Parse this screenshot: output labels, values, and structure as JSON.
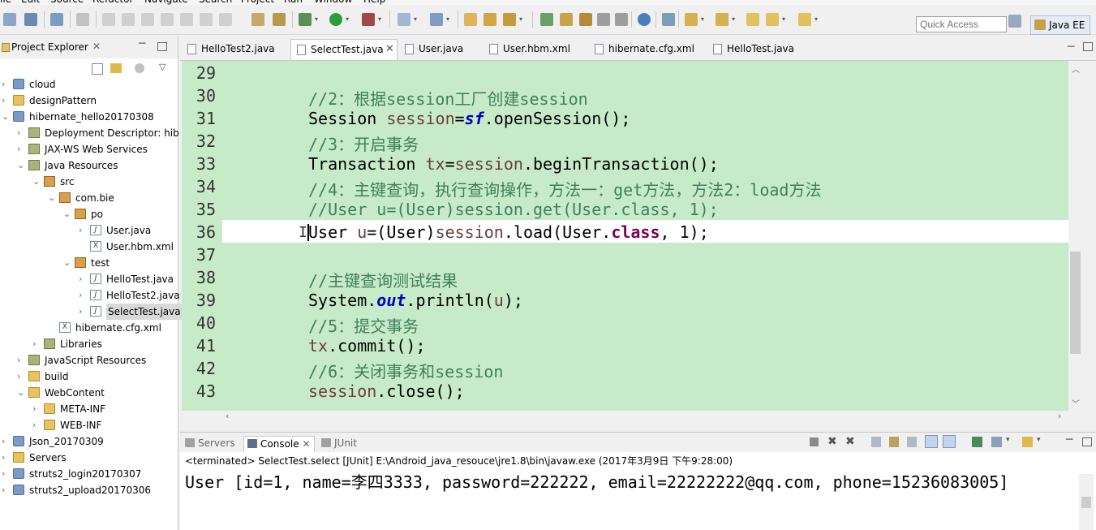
{
  "window": {
    "menu": [
      "ile",
      "Edit",
      "Source",
      "Refactor",
      "Navigate",
      "Search",
      "Project",
      "Run",
      "Window",
      "Help"
    ],
    "quick_access_placeholder": "Quick Access",
    "perspective_label": "Java EE"
  },
  "project_explorer": {
    "title": "Project Explorer",
    "close_glyph": "✕",
    "items": [
      {
        "label": "cloud",
        "indent": 0,
        "icon": "project",
        "twisty": "›"
      },
      {
        "label": "designPattern",
        "indent": 0,
        "icon": "folder",
        "twisty": "›"
      },
      {
        "label": "hibernate_hello20170308",
        "indent": 0,
        "icon": "project",
        "twisty": "⌄"
      },
      {
        "label": "Deployment Descriptor: hib",
        "indent": 1,
        "icon": "library",
        "twisty": "›"
      },
      {
        "label": "JAX-WS Web Services",
        "indent": 1,
        "icon": "library",
        "twisty": "›"
      },
      {
        "label": "Java Resources",
        "indent": 1,
        "icon": "library",
        "twisty": "⌄"
      },
      {
        "label": "src",
        "indent": 2,
        "icon": "package",
        "twisty": "⌄"
      },
      {
        "label": "com.bie",
        "indent": 3,
        "icon": "package",
        "twisty": "⌄"
      },
      {
        "label": "po",
        "indent": 4,
        "icon": "package",
        "twisty": "⌄"
      },
      {
        "label": "User.java",
        "indent": 5,
        "icon": "java",
        "twisty": "›"
      },
      {
        "label": "User.hbm.xml",
        "indent": 5,
        "icon": "xml",
        "twisty": ""
      },
      {
        "label": "test",
        "indent": 4,
        "icon": "package",
        "twisty": "⌄"
      },
      {
        "label": "HelloTest.java",
        "indent": 5,
        "icon": "java",
        "twisty": "›"
      },
      {
        "label": "HelloTest2.java",
        "indent": 5,
        "icon": "java",
        "twisty": "›"
      },
      {
        "label": "SelectTest.java",
        "indent": 5,
        "icon": "java",
        "twisty": "›",
        "selected": true
      },
      {
        "label": "hibernate.cfg.xml",
        "indent": 3,
        "icon": "xml",
        "twisty": ""
      },
      {
        "label": "Libraries",
        "indent": 2,
        "icon": "library",
        "twisty": "›"
      },
      {
        "label": "JavaScript Resources",
        "indent": 1,
        "icon": "library",
        "twisty": "›"
      },
      {
        "label": "build",
        "indent": 1,
        "icon": "folder",
        "twisty": "›"
      },
      {
        "label": "WebContent",
        "indent": 1,
        "icon": "folder",
        "twisty": "⌄"
      },
      {
        "label": "META-INF",
        "indent": 2,
        "icon": "folder",
        "twisty": "›"
      },
      {
        "label": "WEB-INF",
        "indent": 2,
        "icon": "folder",
        "twisty": "›"
      },
      {
        "label": "Json_20170309",
        "indent": 0,
        "icon": "project",
        "twisty": "›"
      },
      {
        "label": "Servers",
        "indent": 0,
        "icon": "folder",
        "twisty": "›"
      },
      {
        "label": "struts2_login20170307",
        "indent": 0,
        "icon": "project",
        "twisty": "›"
      },
      {
        "label": "struts2_upload20170306",
        "indent": 0,
        "icon": "project",
        "twisty": "›"
      }
    ]
  },
  "editor": {
    "tabs": [
      {
        "label": "HelloTest2.java",
        "active": false
      },
      {
        "label": "SelectTest.java",
        "active": true
      },
      {
        "label": "User.java",
        "active": false
      },
      {
        "label": "User.hbm.xml",
        "active": false
      },
      {
        "label": "hibernate.cfg.xml",
        "active": false
      },
      {
        "label": "HelloTest.java",
        "active": false
      }
    ],
    "tab_close_glyph": "✕",
    "lines": [
      {
        "n": "29",
        "parts": []
      },
      {
        "n": "30",
        "parts": [
          {
            "t": "//2：根据session工厂创建session",
            "c": "cmt"
          }
        ]
      },
      {
        "n": "31",
        "parts": [
          {
            "t": "Session ",
            "c": ""
          },
          {
            "t": "session",
            "c": "var"
          },
          {
            "t": "=",
            "c": ""
          },
          {
            "t": "sf",
            "c": "fld"
          },
          {
            "t": ".openSession();",
            "c": ""
          }
        ]
      },
      {
        "n": "32",
        "parts": [
          {
            "t": "//3：开启事务",
            "c": "cmt"
          }
        ]
      },
      {
        "n": "33",
        "parts": [
          {
            "t": "Transaction ",
            "c": ""
          },
          {
            "t": "tx",
            "c": "var"
          },
          {
            "t": "=",
            "c": ""
          },
          {
            "t": "session",
            "c": "var"
          },
          {
            "t": ".beginTransaction();",
            "c": ""
          }
        ]
      },
      {
        "n": "34",
        "parts": [
          {
            "t": "//4：主键查询，执行查询操作，方法一：get方法，方法2：load方法",
            "c": "cmt"
          }
        ]
      },
      {
        "n": "35",
        "parts": [
          {
            "t": "//User u=(User)session.get(User.class, 1);",
            "c": "cmt"
          }
        ]
      },
      {
        "n": "36",
        "parts": [
          {
            "t": "User ",
            "c": ""
          },
          {
            "t": "u",
            "c": "var"
          },
          {
            "t": "=(User)",
            "c": ""
          },
          {
            "t": "session",
            "c": "var"
          },
          {
            "t": ".load(User.",
            "c": ""
          },
          {
            "t": "class",
            "c": "kw"
          },
          {
            "t": ", 1);",
            "c": ""
          }
        ]
      },
      {
        "n": "37",
        "parts": []
      },
      {
        "n": "38",
        "parts": [
          {
            "t": "//主键查询测试结果",
            "c": "cmt"
          }
        ]
      },
      {
        "n": "39",
        "parts": [
          {
            "t": "System.",
            "c": ""
          },
          {
            "t": "out",
            "c": "fld"
          },
          {
            "t": ".println(",
            "c": ""
          },
          {
            "t": "u",
            "c": "var"
          },
          {
            "t": ");",
            "c": ""
          }
        ]
      },
      {
        "n": "40",
        "parts": [
          {
            "t": "//5：提交事务",
            "c": "cmt"
          }
        ]
      },
      {
        "n": "41",
        "parts": [
          {
            "t": "tx",
            "c": "var"
          },
          {
            "t": ".commit();",
            "c": ""
          }
        ]
      },
      {
        "n": "42",
        "parts": [
          {
            "t": "//6：关闭事务和session",
            "c": "cmt"
          }
        ]
      },
      {
        "n": "43",
        "parts": [
          {
            "t": "session",
            "c": "var"
          },
          {
            "t": ".close();",
            "c": ""
          }
        ]
      }
    ]
  },
  "bottom_panel": {
    "tabs": [
      {
        "label": "Servers",
        "active": false
      },
      {
        "label": "Console",
        "active": true
      },
      {
        "label": "JUnit",
        "active": false
      }
    ],
    "status": "<terminated> SelectTest.select [JUnit] E:\\Android_java_resouce\\jre1.8\\bin\\javaw.exe (2017年3月9日 下午9:28:00)",
    "output": "User [id=1, name=李四3333, password=222222, email=22222222@qq.com, phone=15236083005]"
  }
}
